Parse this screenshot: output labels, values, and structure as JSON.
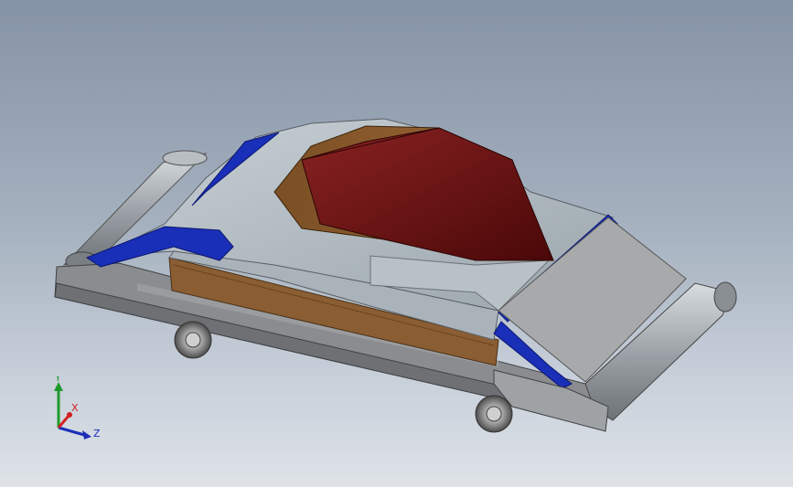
{
  "viewport": {
    "background_top": "#8593a6",
    "background_bottom": "#dfe3e8"
  },
  "colors": {
    "body_grey": "#b4bec4",
    "accent_blue": "#1a2fb8",
    "canopy_red": "#6b1414",
    "canopy_brown": "#8a5a2c",
    "frame_grey": "#8e9093",
    "wheel_grey": "#9a9a9a"
  },
  "triad": {
    "x_label": "X",
    "y_label": "Y",
    "z_label": "Z",
    "x_color": "#d42020",
    "y_color": "#1f9a2a",
    "z_color": "#1a2fb8"
  }
}
